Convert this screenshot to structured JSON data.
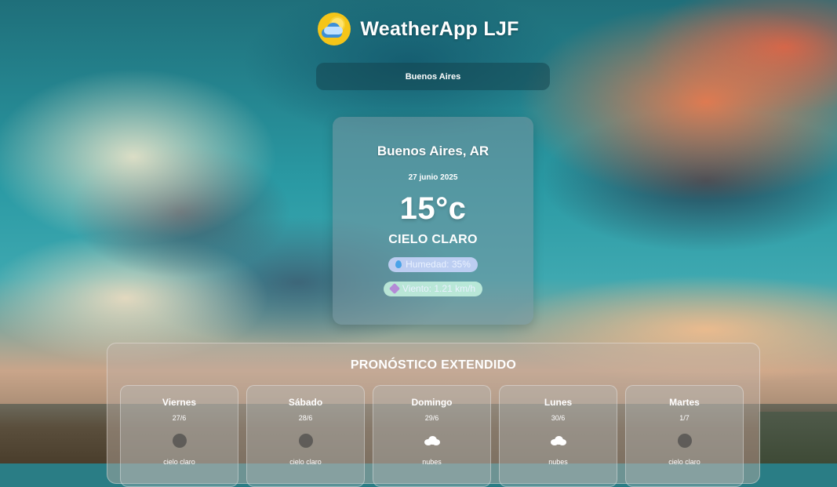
{
  "header": {
    "title": "WeatherApp LJF",
    "logo_icon": "sun-cloud-icon"
  },
  "search": {
    "value": "Buenos Aires"
  },
  "current": {
    "city": "Buenos Aires, AR",
    "date": "27 junio 2025",
    "temperature": "15°c",
    "condition": "CIELO CLARO",
    "humidity": "Humedad: 35%",
    "wind": "Viento: 1.21 km/h"
  },
  "forecast": {
    "title": "PRONÓSTICO EXTENDIDO",
    "days": [
      {
        "name": "Viernes",
        "date": "27/6",
        "icon": "clear-icon",
        "desc": "cielo claro"
      },
      {
        "name": "Sábado",
        "date": "28/6",
        "icon": "clear-icon",
        "desc": "cielo claro"
      },
      {
        "name": "Domingo",
        "date": "29/6",
        "icon": "cloud-icon",
        "desc": "nubes"
      },
      {
        "name": "Lunes",
        "date": "30/6",
        "icon": "cloud-icon",
        "desc": "nubes"
      },
      {
        "name": "Martes",
        "date": "1/7",
        "icon": "clear-icon",
        "desc": "cielo claro"
      }
    ]
  },
  "colors": {
    "logo_bg": "#f5c518",
    "humidity_pill": "#cdd7ff",
    "wind_pill": "#c8f5e1"
  }
}
